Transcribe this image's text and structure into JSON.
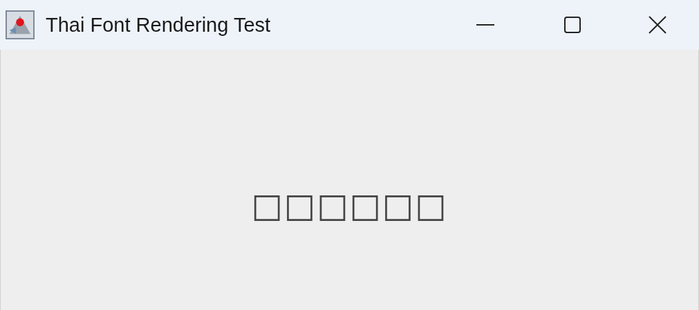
{
  "window": {
    "title": "Thai Font Rendering Test"
  },
  "content": {
    "text": "□□□□□□"
  }
}
